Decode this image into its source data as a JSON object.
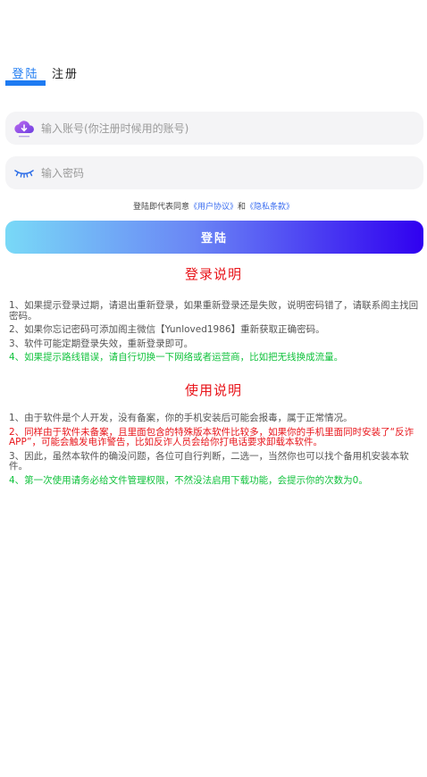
{
  "tabs": {
    "login": "登陆",
    "register": "注册"
  },
  "account": {
    "placeholder": "输入账号(你注册时候用的账号)",
    "value": ""
  },
  "password": {
    "placeholder": "输入密码",
    "value": ""
  },
  "agreement": {
    "prefix": "登陆即代表同意",
    "user_agreement": "《用户协议》",
    "and": "和",
    "privacy_policy": "《隐私条款》"
  },
  "login_button": "登陆",
  "login_section": {
    "title": "登录说明",
    "items": [
      "1、如果提示登录过期，请退出重新登录，如果重新登录还是失败，说明密码错了，请联系阁主找回密码。",
      "2、如果你忘记密码可添加阁主微信【Yunloved1986】重新获取正确密码。",
      "3、软件可能定期登录失效，重新登录即可。",
      "4、如果提示路线错误，请自行切换一下网络或者运营商，比如把无线换成流量。"
    ]
  },
  "usage_section": {
    "title": "使用说明",
    "items": [
      "1、由于软件是个人开发，没有备案，你的手机安装后可能会报毒，属于正常情况。",
      "2、同样由于软件未备案，且里面包含的特殊版本软件比较多，如果你的手机里面同时安装了“反诈APP”，可能会触发电诈警告，比如反诈人员会给你打电话要求卸载本软件。",
      "3、因此，虽然本软件的确没问题，各位可自行判断，二选一，当然你也可以找个备用机安装本软件。",
      "4、第一次使用请务必给文件管理权限，不然没法启用下载功能，会提示你的次数为0。"
    ]
  },
  "colors": {
    "accent": "#1e7bf2",
    "warning": "#e8141a",
    "notice": "#10c23c"
  }
}
